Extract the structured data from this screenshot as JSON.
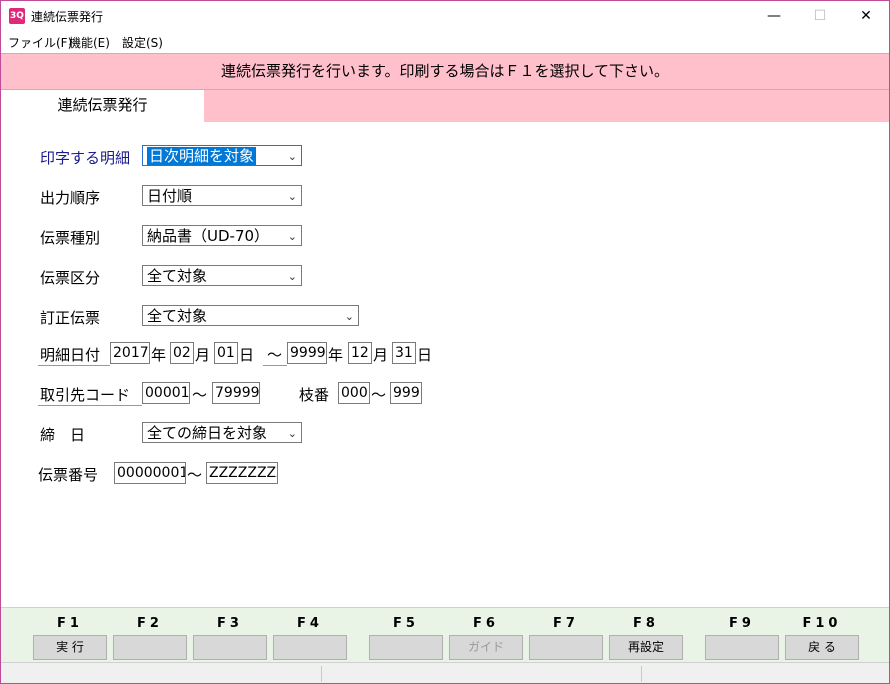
{
  "window": {
    "title": "連続伝票発行",
    "icon_text": "3Q",
    "minimize": "—",
    "maximize": "☐",
    "close": "✕"
  },
  "menu": [
    "ファイル(F)",
    "機能(E)",
    "設定(S)"
  ],
  "banner": "連続伝票発行を行います。印刷する場合はＦ１を選択して下さい。",
  "tab": "連続伝票発行",
  "form": {
    "print_detail": {
      "label": "印字する明細",
      "value": "日次明細を対象"
    },
    "output_order": {
      "label": "出力順序",
      "value": "日付順"
    },
    "slip_type": {
      "label": "伝票種別",
      "value": "納品書（UD-70）"
    },
    "slip_category": {
      "label": "伝票区分",
      "value": "全て対象"
    },
    "correction_slip": {
      "label": "訂正伝票",
      "value": "全て対象"
    },
    "detail_date": {
      "label": "明細日付",
      "from_year": "2017",
      "from_month": "02",
      "from_day": "01",
      "to_year": "9999",
      "to_month": "12",
      "to_day": "31",
      "year_suffix": "年",
      "month_suffix": "月",
      "day_suffix": "日",
      "range_sep": "～"
    },
    "customer_code": {
      "label": "取引先コード",
      "from": "00001",
      "to": "79999",
      "range_sep": "～"
    },
    "branch_no": {
      "label": "枝番",
      "from": "000",
      "to": "999",
      "range_sep": "～"
    },
    "closing_day": {
      "label": "締　日",
      "value": "全ての締日を対象"
    },
    "slip_number": {
      "label": "伝票番号",
      "from": "00000001",
      "to": "ZZZZZZZZ",
      "range_sep": "～"
    }
  },
  "fkeys": [
    {
      "key": "F1",
      "label": "実 行"
    },
    {
      "key": "F2",
      "label": ""
    },
    {
      "key": "F3",
      "label": ""
    },
    {
      "key": "F4",
      "label": ""
    },
    {
      "key": "F5",
      "label": ""
    },
    {
      "key": "F6",
      "label": "ガイド"
    },
    {
      "key": "F7",
      "label": ""
    },
    {
      "key": "F8",
      "label": "再設定"
    },
    {
      "key": "F9",
      "label": ""
    },
    {
      "key": "F10",
      "label": "戻 る"
    }
  ],
  "colors": {
    "banner_bg": "#ffc0cb",
    "fkey_bar_bg": "#eaf4e6",
    "window_border": "#c04a9a",
    "focus_highlight": "#0078d7"
  }
}
